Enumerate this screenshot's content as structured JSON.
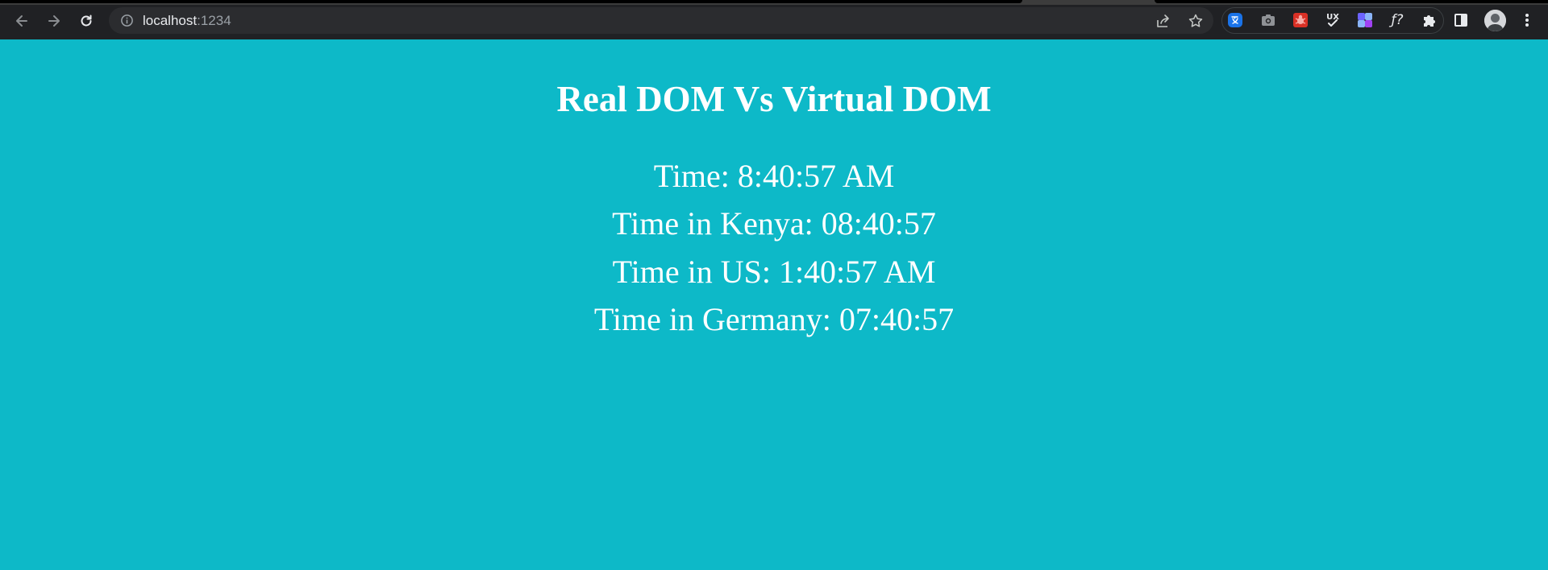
{
  "browser": {
    "url_host": "localhost",
    "url_port": ":1234"
  },
  "page": {
    "title": "Real DOM Vs Virtual DOM",
    "times": [
      "Time: 8:40:57 AM",
      "Time in Kenya: 08:40:57",
      "Time in US: 1:40:57 AM",
      "Time in Germany: 07:40:57"
    ]
  },
  "icons": {
    "back": "arrow-left-icon",
    "forward": "arrow-right-icon",
    "reload": "reload-icon",
    "info": "info-icon",
    "share": "share-icon",
    "bookmark": "star-icon",
    "extensions": "puzzle-icon",
    "side_panel": "side-panel-icon",
    "menu": "kebab-menu-icon"
  },
  "extensions": {
    "ux_label": "UX",
    "fx_label": "ƒ?"
  },
  "colors": {
    "page_background": "#0db9c8",
    "toolbar": "#202124",
    "text": "#ffffff"
  }
}
